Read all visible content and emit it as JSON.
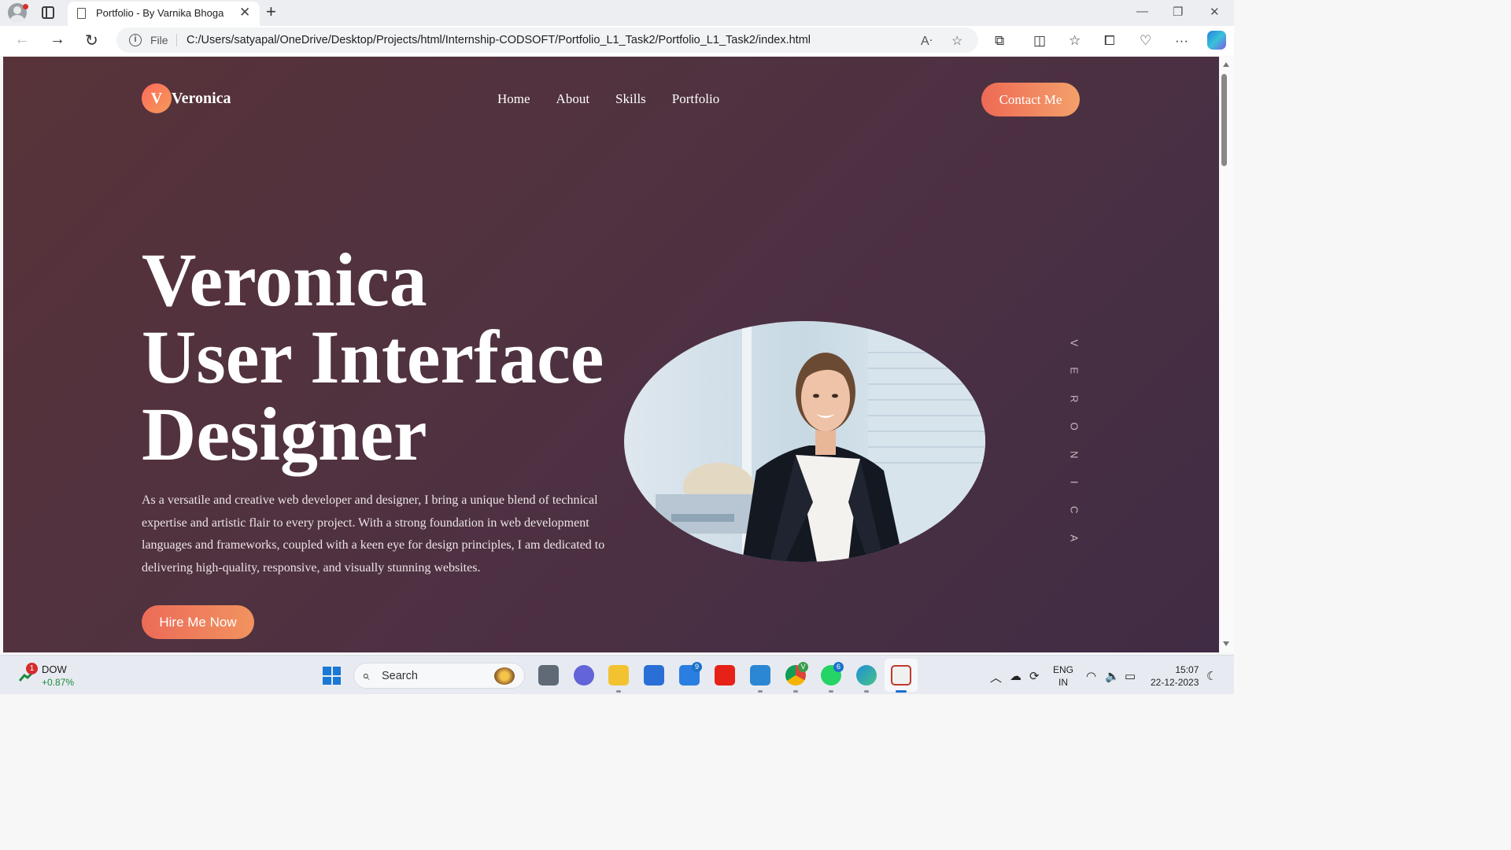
{
  "browser": {
    "tab_title": "Portfolio - By Varnika Bhoga",
    "file_label": "File",
    "url": "C:/Users/satyapal/OneDrive/Desktop/Projects/html/Internship-CODSOFT/Portfolio_L1_Task2/Portfolio_L1_Task2/index.html"
  },
  "site": {
    "logo_letter": "V",
    "logo_name": "Veronica",
    "nav": [
      "Home",
      "About",
      "Skills",
      "Portfolio"
    ],
    "contact_label": "Contact Me",
    "hero": {
      "line1": "Veronica",
      "line2": "User Interface",
      "line3": "Designer",
      "description": "As a versatile and creative web developer and designer, I bring a unique blend of technical expertise and artistic flair to every project. With a strong foundation in web development languages and frameworks, coupled with a keen eye for design principles, I am dedicated to delivering high-quality, responsive, and visually stunning websites.",
      "cta_label": "Hire Me Now"
    },
    "vertical_letters": [
      "V",
      "E",
      "R",
      "O",
      "N",
      "I",
      "C",
      "A"
    ]
  },
  "taskbar": {
    "stock_name": "DOW",
    "stock_change": "+0.87%",
    "stock_badge": "1",
    "search_label": "Search",
    "badges": {
      "mail": "9",
      "whatsapp": "6",
      "chrome": "V"
    },
    "lang_line1": "ENG",
    "lang_line2": "IN",
    "time": "15:07",
    "date": "22-12-2023"
  },
  "colors": {
    "page_bg_start": "#583339",
    "page_bg_end": "#402c44",
    "accent_start": "#ee6a55",
    "accent_end": "#f4a06a"
  },
  "icons": [
    "profile-icon",
    "tabs-icon",
    "page-icon",
    "close-icon",
    "plus-icon",
    "back-icon",
    "forward-icon",
    "refresh-icon",
    "info-icon",
    "read-aloud-icon",
    "star-icon",
    "extensions-icon",
    "split-screen-icon",
    "favorites-icon",
    "collections-icon",
    "health-icon",
    "more-icon",
    "copilot-icon",
    "windows-icon",
    "search-icon",
    "wifi-icon",
    "volume-icon",
    "battery-icon"
  ]
}
